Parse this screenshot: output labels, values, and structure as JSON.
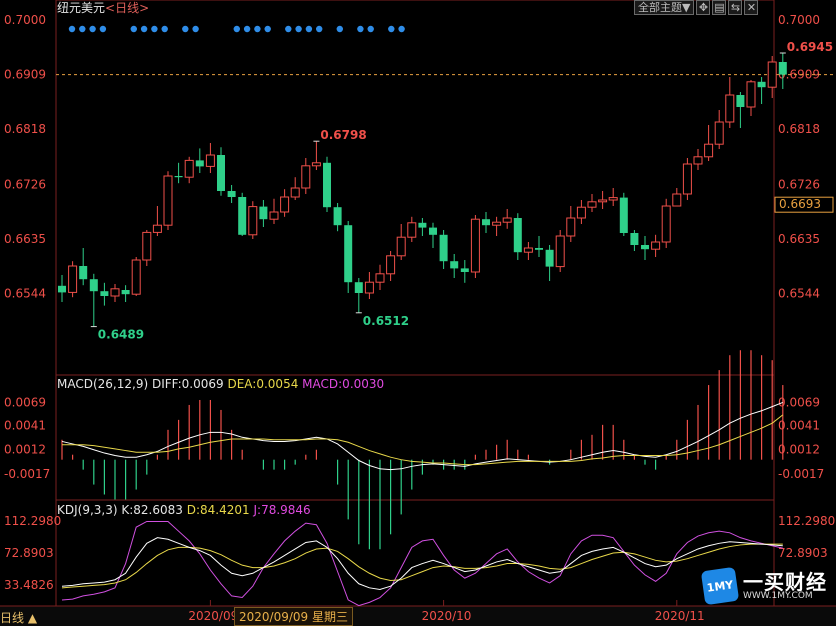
{
  "header": {
    "symbol": "纽元美元",
    "period_tag": "<日线>"
  },
  "toolbar": {
    "theme_label": "全部主题▼",
    "icons": [
      "move-icon",
      "chart-icon",
      "swap-icon",
      "close-icon"
    ]
  },
  "indicators": {
    "macd": {
      "name": "MACD(26,12,9)",
      "diff": "DIFF:0.0069",
      "dea": "DEA:0.0054",
      "macd": "MACD:0.0030"
    },
    "kdj": {
      "name": "KDJ(9,3,3)",
      "k": "K:82.6083",
      "d": "D:84.4201",
      "j": "J:78.9846"
    }
  },
  "footer": {
    "period": "日线 ▲",
    "cursor_date": "2020/09/09 星期三"
  },
  "logo": {
    "name": "一买财经",
    "url": "WWW.1MY.COM",
    "badge": "1MY"
  },
  "chart_data": {
    "type": "candlestick",
    "title": "纽元美元",
    "price_axis": {
      "ylim": [
        0.645,
        0.7
      ],
      "ticks": [
        "0.7000",
        "0.6909",
        "0.6818",
        "0.6726",
        "0.6635",
        "0.6544"
      ]
    },
    "current_price": "0.6909",
    "right_tag_price": "0.6693",
    "annotations": [
      {
        "text": "0.6945",
        "index": 68
      },
      {
        "text": "0.6798",
        "index": 24
      },
      {
        "text": "0.6489",
        "index": 3
      },
      {
        "text": "0.6512",
        "index": 28
      }
    ],
    "x_labels": [
      {
        "text": "2020/09",
        "index": 14
      },
      {
        "text": "2020/10",
        "index": 36
      },
      {
        "text": "2020/11",
        "index": 58
      }
    ],
    "dots_groups": [
      [
        0,
        1,
        2,
        3
      ],
      [
        6,
        7,
        8,
        9
      ],
      [
        11,
        12
      ],
      [
        16,
        17,
        18,
        19
      ],
      [
        21,
        22,
        23,
        24
      ],
      [
        26
      ],
      [
        28,
        29
      ],
      [
        31,
        32
      ]
    ],
    "candles": [
      [
        0.6557,
        0.6546,
        0.6575,
        0.653
      ],
      [
        0.6546,
        0.659,
        0.6598,
        0.6538
      ],
      [
        0.659,
        0.6568,
        0.662,
        0.6558
      ],
      [
        0.6568,
        0.6548,
        0.6577,
        0.6489
      ],
      [
        0.6548,
        0.654,
        0.6562,
        0.6524
      ],
      [
        0.654,
        0.6552,
        0.656,
        0.653
      ],
      [
        0.655,
        0.6543,
        0.6558,
        0.653
      ],
      [
        0.6543,
        0.66,
        0.6605,
        0.654
      ],
      [
        0.66,
        0.6646,
        0.665,
        0.659
      ],
      [
        0.6646,
        0.6658,
        0.669,
        0.664
      ],
      [
        0.6658,
        0.674,
        0.6748,
        0.665
      ],
      [
        0.674,
        0.6738,
        0.6762,
        0.6728
      ],
      [
        0.6738,
        0.6766,
        0.6772,
        0.6728
      ],
      [
        0.6766,
        0.6756,
        0.6786,
        0.6745
      ],
      [
        0.6756,
        0.6775,
        0.6795,
        0.6745
      ],
      [
        0.6775,
        0.6715,
        0.6788,
        0.6707
      ],
      [
        0.6715,
        0.6705,
        0.6725,
        0.6695
      ],
      [
        0.6705,
        0.6642,
        0.6712,
        0.664
      ],
      [
        0.6642,
        0.6689,
        0.6698,
        0.6635
      ],
      [
        0.6689,
        0.6668,
        0.67,
        0.6655
      ],
      [
        0.6668,
        0.668,
        0.6702,
        0.666
      ],
      [
        0.668,
        0.6705,
        0.6718,
        0.6672
      ],
      [
        0.6705,
        0.672,
        0.6738,
        0.67
      ],
      [
        0.672,
        0.6757,
        0.677,
        0.671
      ],
      [
        0.6757,
        0.6762,
        0.6798,
        0.675
      ],
      [
        0.6762,
        0.6688,
        0.6772,
        0.668
      ],
      [
        0.6688,
        0.6658,
        0.6695,
        0.6648
      ],
      [
        0.6658,
        0.6563,
        0.6665,
        0.6545
      ],
      [
        0.6563,
        0.6545,
        0.657,
        0.6512
      ],
      [
        0.6545,
        0.6563,
        0.658,
        0.6535
      ],
      [
        0.6563,
        0.6577,
        0.6592,
        0.655
      ],
      [
        0.6577,
        0.6607,
        0.6615,
        0.6565
      ],
      [
        0.6607,
        0.6638,
        0.666,
        0.66
      ],
      [
        0.6638,
        0.6662,
        0.6672,
        0.663
      ],
      [
        0.6662,
        0.6654,
        0.667,
        0.664
      ],
      [
        0.6654,
        0.6642,
        0.6662,
        0.662
      ],
      [
        0.6642,
        0.6598,
        0.665,
        0.6585
      ],
      [
        0.6598,
        0.6586,
        0.661,
        0.657
      ],
      [
        0.6586,
        0.658,
        0.66,
        0.6562
      ],
      [
        0.658,
        0.6668,
        0.6675,
        0.657
      ],
      [
        0.6668,
        0.6658,
        0.668,
        0.6645
      ],
      [
        0.6658,
        0.6663,
        0.6672,
        0.664
      ],
      [
        0.6663,
        0.667,
        0.6685,
        0.6652
      ],
      [
        0.667,
        0.6613,
        0.6678,
        0.66
      ],
      [
        0.6613,
        0.662,
        0.663,
        0.66
      ],
      [
        0.662,
        0.6617,
        0.664,
        0.6605
      ],
      [
        0.6617,
        0.6589,
        0.6625,
        0.6565
      ],
      [
        0.6589,
        0.664,
        0.665,
        0.658
      ],
      [
        0.664,
        0.667,
        0.669,
        0.663
      ],
      [
        0.667,
        0.6688,
        0.67,
        0.666
      ],
      [
        0.6688,
        0.6697,
        0.671,
        0.668
      ],
      [
        0.6697,
        0.67,
        0.6715,
        0.6685
      ],
      [
        0.67,
        0.6704,
        0.672,
        0.669
      ],
      [
        0.6704,
        0.6645,
        0.6712,
        0.664
      ],
      [
        0.6645,
        0.6625,
        0.665,
        0.6615
      ],
      [
        0.6625,
        0.6618,
        0.664,
        0.66
      ],
      [
        0.6618,
        0.663,
        0.6642,
        0.6605
      ],
      [
        0.663,
        0.669,
        0.6702,
        0.662
      ],
      [
        0.669,
        0.671,
        0.672,
        0.669
      ],
      [
        0.671,
        0.676,
        0.677,
        0.67
      ],
      [
        0.676,
        0.6772,
        0.6785,
        0.675
      ],
      [
        0.6772,
        0.6793,
        0.6825,
        0.6765
      ],
      [
        0.6793,
        0.683,
        0.685,
        0.6785
      ],
      [
        0.683,
        0.6875,
        0.6905,
        0.682
      ],
      [
        0.6875,
        0.6855,
        0.688,
        0.682
      ],
      [
        0.6855,
        0.6897,
        0.69,
        0.684
      ],
      [
        0.6897,
        0.6888,
        0.6905,
        0.686
      ],
      [
        0.6888,
        0.693,
        0.694,
        0.687
      ],
      [
        0.693,
        0.6909,
        0.6945,
        0.6885
      ]
    ],
    "macd": {
      "ylim": [
        -0.0045,
        0.0078
      ],
      "ticks": [
        "0.0069",
        "0.0041",
        "0.0012",
        "-0.0017"
      ],
      "diff": [
        0.0022,
        0.0019,
        0.0016,
        0.0012,
        0.0008,
        0.0005,
        0.0003,
        0.0003,
        0.0006,
        0.001,
        0.0016,
        0.0021,
        0.0026,
        0.003,
        0.0033,
        0.0033,
        0.0031,
        0.0027,
        0.0025,
        0.0023,
        0.0022,
        0.0022,
        0.0023,
        0.0025,
        0.0027,
        0.0025,
        0.0019,
        0.0009,
        -0.0001,
        -0.0007,
        -0.0011,
        -0.0012,
        -0.0011,
        -0.0008,
        -0.0006,
        -0.0005,
        -0.0006,
        -0.0007,
        -0.0008,
        -0.0005,
        -0.0003,
        -0.0001,
        0.0001,
        0.0,
        -0.0001,
        -0.0002,
        -0.0003,
        -0.0002,
        0.0,
        0.0003,
        0.0006,
        0.0009,
        0.0011,
        0.0009,
        0.0006,
        0.0004,
        0.0003,
        0.0006,
        0.001,
        0.0016,
        0.0022,
        0.0029,
        0.0036,
        0.0044,
        0.005,
        0.0055,
        0.0059,
        0.0064,
        0.0069
      ],
      "dea": [
        0.0018,
        0.0018,
        0.0018,
        0.0017,
        0.0015,
        0.0013,
        0.0011,
        0.0009,
        0.0009,
        0.0009,
        0.001,
        0.0013,
        0.0015,
        0.0018,
        0.0021,
        0.0023,
        0.0025,
        0.0025,
        0.0025,
        0.0025,
        0.0024,
        0.0024,
        0.0024,
        0.0024,
        0.0025,
        0.0025,
        0.0024,
        0.0021,
        0.0016,
        0.0011,
        0.0007,
        0.0003,
        0.0,
        -0.0002,
        -0.0003,
        -0.0004,
        -0.0004,
        -0.0005,
        -0.0006,
        -0.0006,
        -0.0005,
        -0.0004,
        -0.0003,
        -0.0002,
        -0.0002,
        -0.0002,
        -0.0002,
        -0.0002,
        -0.0002,
        -0.0001,
        0.0001,
        0.0002,
        0.0004,
        0.0005,
        0.0005,
        0.0005,
        0.0005,
        0.0005,
        0.0006,
        0.0008,
        0.0011,
        0.0014,
        0.0018,
        0.0023,
        0.0028,
        0.0033,
        0.0038,
        0.0044,
        0.0054
      ]
    },
    "kdj": {
      "ylim": [
        10,
        120
      ],
      "ticks": [
        "112.2980",
        "72.8903",
        "33.4826"
      ],
      "k": [
        32,
        33,
        35,
        36,
        37,
        40,
        48,
        68,
        85,
        92,
        90,
        85,
        80,
        76,
        70,
        58,
        48,
        45,
        48,
        55,
        62,
        70,
        78,
        86,
        88,
        80,
        66,
        48,
        35,
        30,
        28,
        32,
        42,
        55,
        60,
        64,
        60,
        55,
        50,
        52,
        57,
        62,
        65,
        60,
        56,
        52,
        48,
        50,
        60,
        70,
        75,
        78,
        80,
        74,
        67,
        60,
        56,
        58,
        66,
        72,
        78,
        82,
        85,
        87,
        86,
        85,
        84,
        83,
        82
      ],
      "d": [
        30,
        31,
        32,
        33,
        34,
        36,
        40,
        49,
        60,
        70,
        77,
        80,
        80,
        79,
        76,
        71,
        64,
        58,
        55,
        55,
        57,
        61,
        66,
        73,
        78,
        79,
        75,
        66,
        56,
        48,
        42,
        39,
        40,
        45,
        50,
        55,
        57,
        56,
        54,
        54,
        55,
        57,
        60,
        60,
        59,
        57,
        54,
        53,
        55,
        60,
        65,
        69,
        73,
        74,
        72,
        68,
        64,
        62,
        63,
        66,
        70,
        74,
        78,
        81,
        83,
        84,
        84,
        84,
        84
      ],
      "j": [
        15,
        16,
        20,
        22,
        25,
        30,
        60,
        105,
        112,
        112,
        112,
        100,
        88,
        72,
        52,
        35,
        20,
        18,
        32,
        55,
        72,
        88,
        100,
        110,
        108,
        85,
        50,
        15,
        8,
        12,
        18,
        30,
        55,
        80,
        88,
        90,
        70,
        52,
        42,
        48,
        60,
        72,
        78,
        62,
        50,
        42,
        36,
        45,
        72,
        88,
        95,
        95,
        92,
        75,
        58,
        46,
        38,
        48,
        72,
        86,
        94,
        98,
        100,
        98,
        92,
        88,
        85,
        82,
        79
      ]
    }
  }
}
